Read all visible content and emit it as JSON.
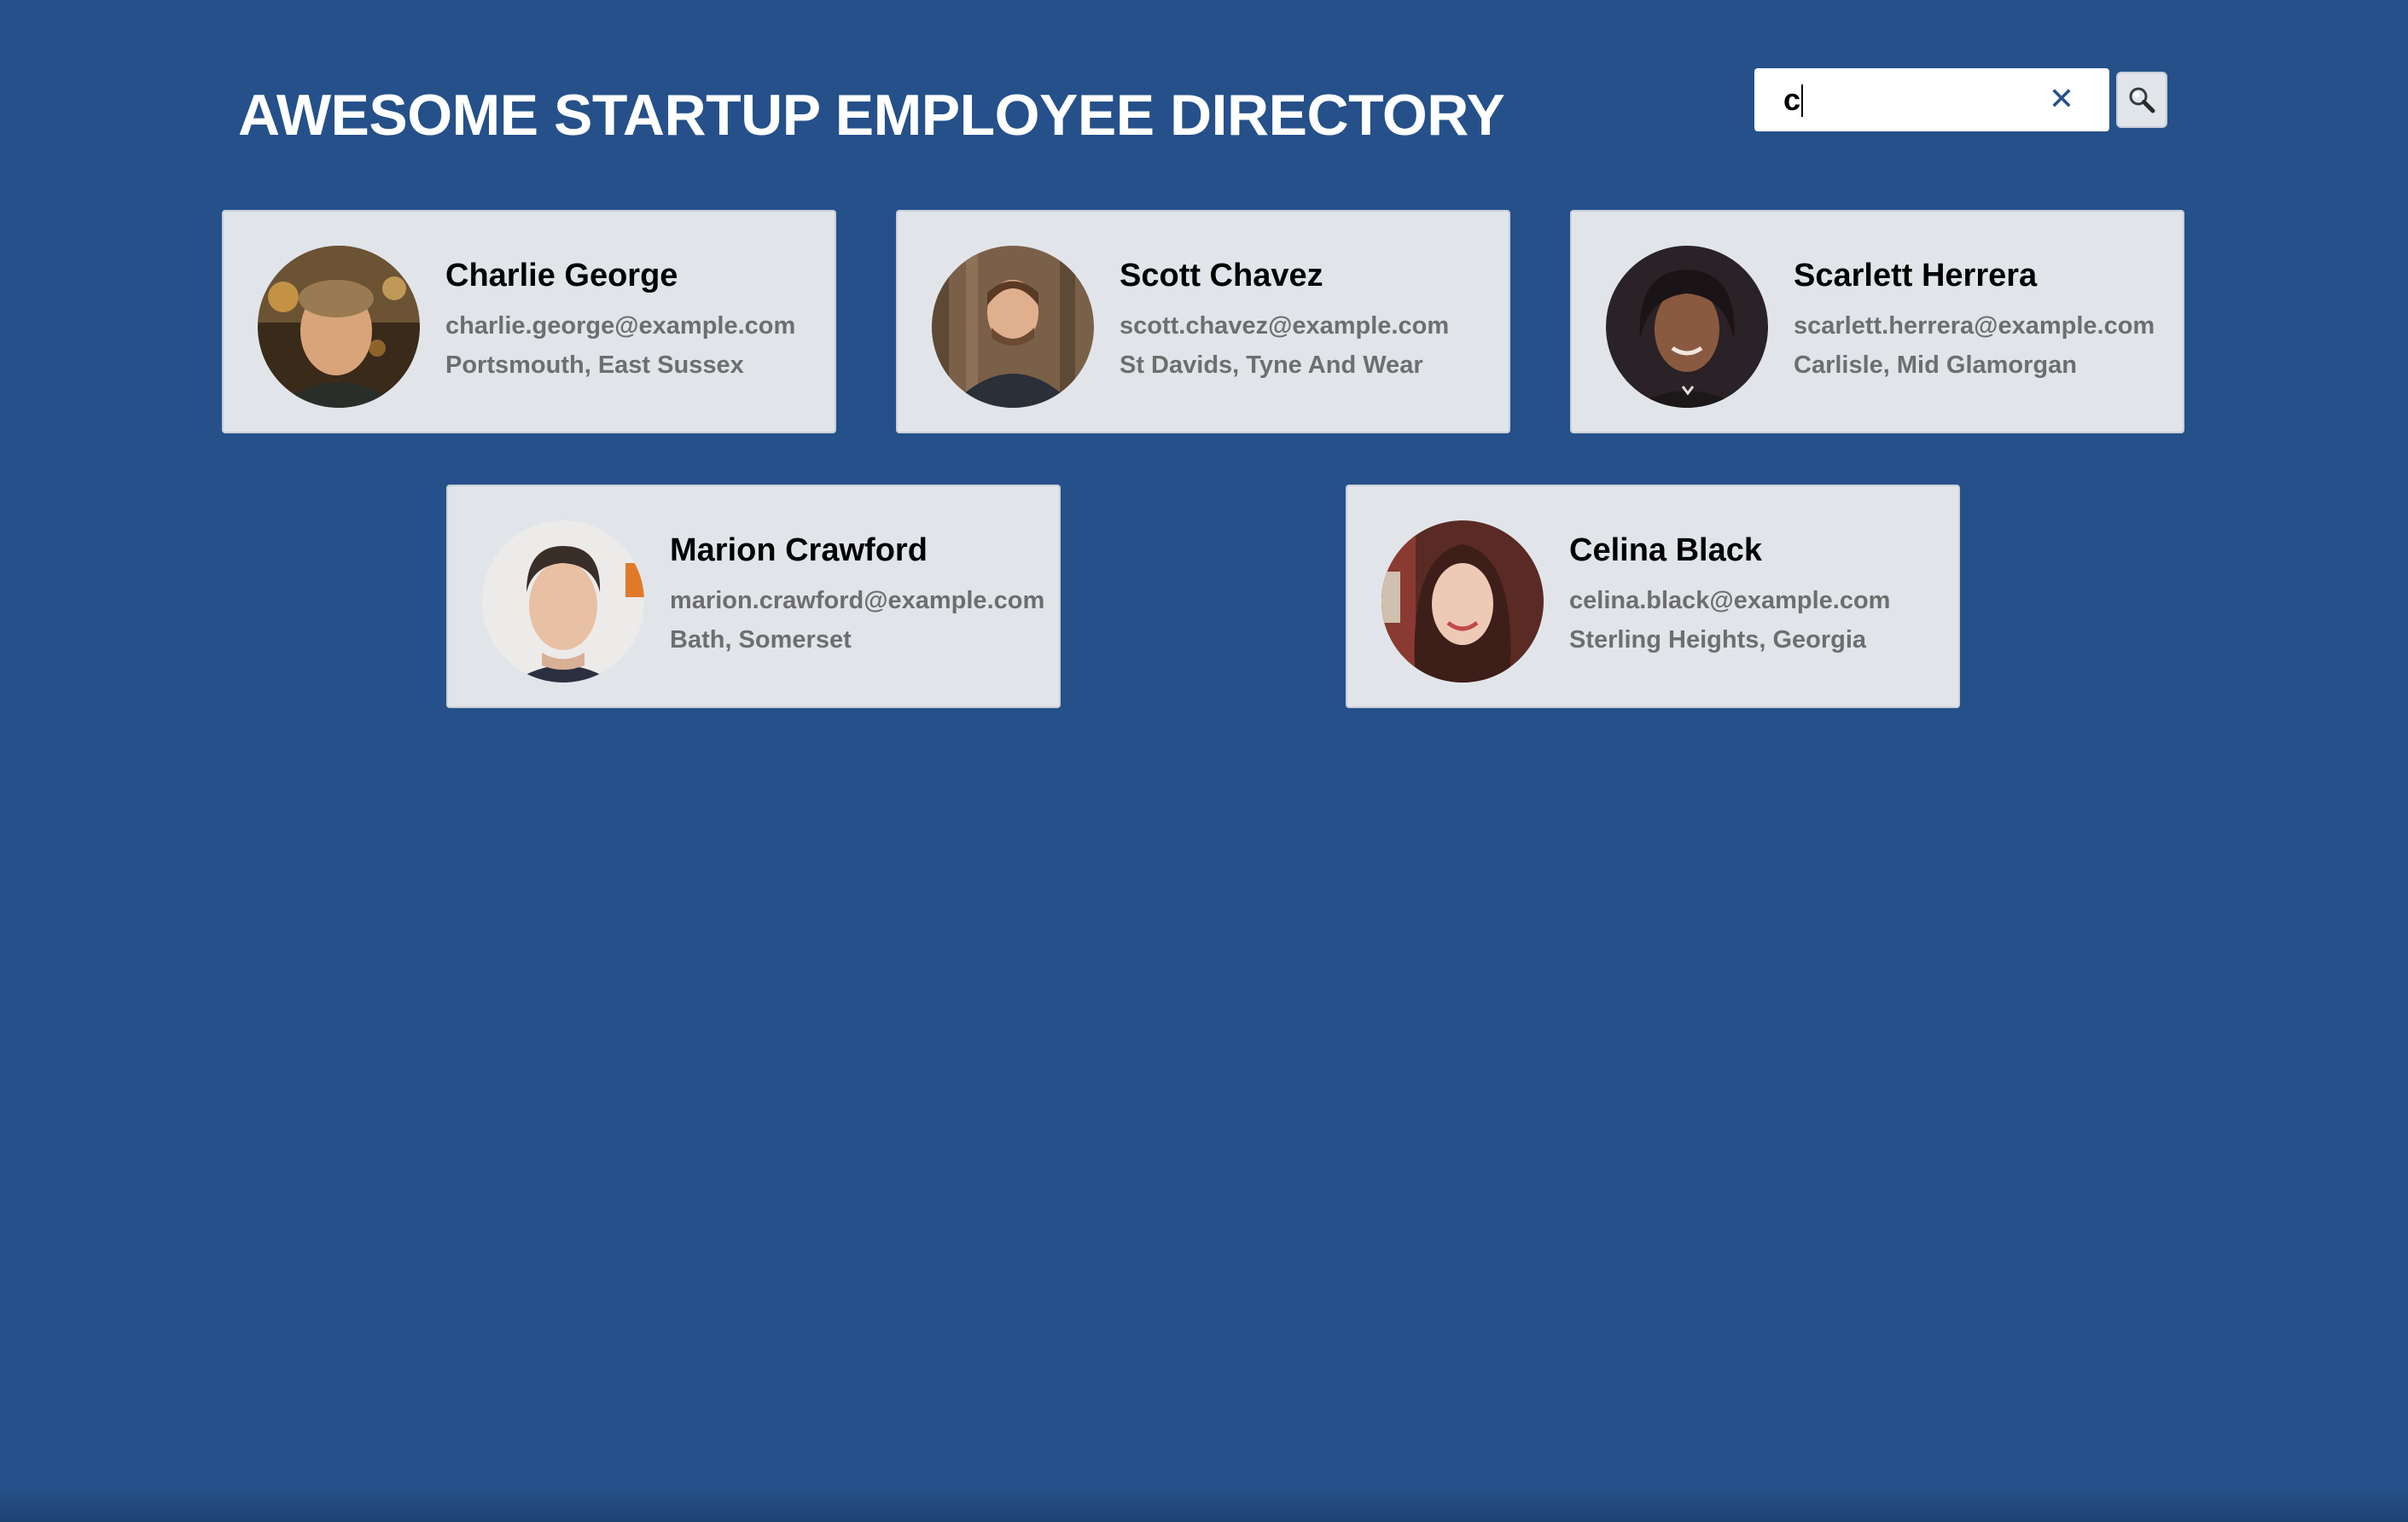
{
  "header": {
    "title": "AWESOME STARTUP EMPLOYEE DIRECTORY"
  },
  "search": {
    "value": "c",
    "clear_icon": "close-icon",
    "button_icon": "search-icon"
  },
  "employees": [
    {
      "name": "Charlie George",
      "email": "charlie.george@example.com",
      "location": "Portsmouth, East Sussex"
    },
    {
      "name": "Scott Chavez",
      "email": "scott.chavez@example.com",
      "location": "St Davids, Tyne And Wear"
    },
    {
      "name": "Scarlett Herrera",
      "email": "scarlett.herrera@example.com",
      "location": "Carlisle, Mid Glamorgan"
    },
    {
      "name": "Marion Crawford",
      "email": "marion.crawford@example.com",
      "location": "Bath, Somerset"
    },
    {
      "name": "Celina Black",
      "email": "celina.black@example.com",
      "location": "Sterling Heights, Georgia"
    }
  ],
  "colors": {
    "background": "#25508a",
    "card": "#e1e5ea",
    "secondary_text": "#6e6e6e"
  }
}
